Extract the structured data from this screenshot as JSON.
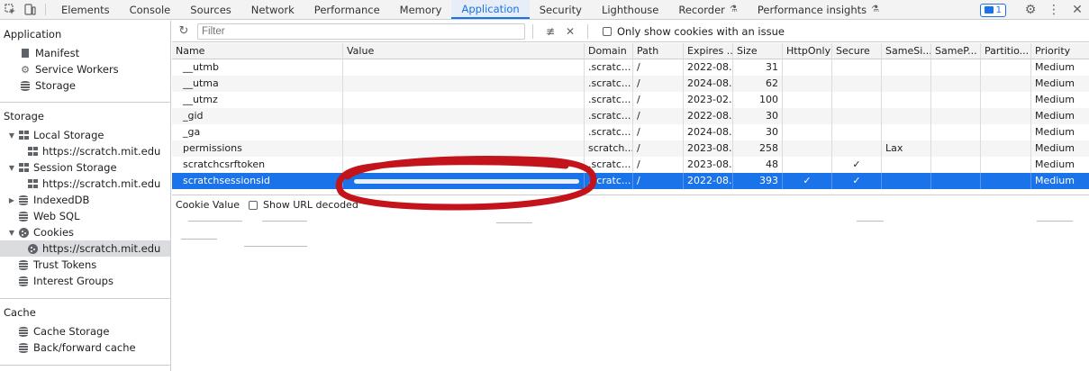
{
  "toolbar": {
    "tabs": [
      "Elements",
      "Console",
      "Sources",
      "Network",
      "Performance",
      "Memory",
      "Application",
      "Security",
      "Lighthouse",
      "Recorder",
      "Performance insights"
    ],
    "active_tab": "Application",
    "issues_count": "1"
  },
  "sidebar": {
    "application_title": "Application",
    "application_items": [
      "Manifest",
      "Service Workers",
      "Storage"
    ],
    "storage_title": "Storage",
    "local_storage": "Local Storage",
    "local_storage_origin": "https://scratch.mit.edu",
    "session_storage": "Session Storage",
    "session_storage_origin": "https://scratch.mit.edu",
    "indexeddb": "IndexedDB",
    "websql": "Web SQL",
    "cookies": "Cookies",
    "cookies_origin": "https://scratch.mit.edu",
    "trust_tokens": "Trust Tokens",
    "interest_groups": "Interest Groups",
    "cache_title": "Cache",
    "cache_storage": "Cache Storage",
    "bf_cache": "Back/forward cache"
  },
  "filter": {
    "placeholder": "Filter",
    "only_issue_label": "Only show cookies with an issue"
  },
  "table": {
    "columns": [
      "Name",
      "Value",
      "Domain",
      "Path",
      "Expires ...",
      "Size",
      "HttpOnly",
      "Secure",
      "SameSi...",
      "SameP...",
      "Partitio...",
      "Priority"
    ],
    "rows": [
      {
        "name": "__utmb",
        "domain": ".scratc...",
        "path": "/",
        "expires": "2022-08...",
        "size": "31",
        "httponly": "",
        "secure": "",
        "samesite": "",
        "priority": "Medium"
      },
      {
        "name": "__utma",
        "domain": ".scratc...",
        "path": "/",
        "expires": "2024-08...",
        "size": "62",
        "httponly": "",
        "secure": "",
        "samesite": "",
        "priority": "Medium"
      },
      {
        "name": "__utmz",
        "domain": ".scratc...",
        "path": "/",
        "expires": "2023-02...",
        "size": "100",
        "httponly": "",
        "secure": "",
        "samesite": "",
        "priority": "Medium"
      },
      {
        "name": "_gid",
        "domain": ".scratc...",
        "path": "/",
        "expires": "2022-08...",
        "size": "30",
        "httponly": "",
        "secure": "",
        "samesite": "",
        "priority": "Medium"
      },
      {
        "name": "_ga",
        "domain": ".scratc...",
        "path": "/",
        "expires": "2024-08...",
        "size": "30",
        "httponly": "",
        "secure": "",
        "samesite": "",
        "priority": "Medium"
      },
      {
        "name": "permissions",
        "domain": "scratch...",
        "path": "/",
        "expires": "2023-08...",
        "size": "258",
        "httponly": "",
        "secure": "",
        "samesite": "Lax",
        "priority": "Medium"
      },
      {
        "name": "scratchcsrftoken",
        "domain": ".scratc...",
        "path": "/",
        "expires": "2023-08...",
        "size": "48",
        "httponly": "",
        "secure": "✓",
        "samesite": "",
        "priority": "Medium"
      },
      {
        "name": "scratchsessionsid",
        "domain": ".scratc...",
        "path": "/",
        "expires": "2022-08...",
        "size": "393",
        "httponly": "✓",
        "secure": "✓",
        "samesite": "",
        "priority": "Medium"
      }
    ]
  },
  "detail": {
    "title": "Cookie Value",
    "show_url_decoded": "Show URL decoded"
  },
  "colors": {
    "accent": "#1a73e8",
    "annotation": "#c3141b"
  }
}
